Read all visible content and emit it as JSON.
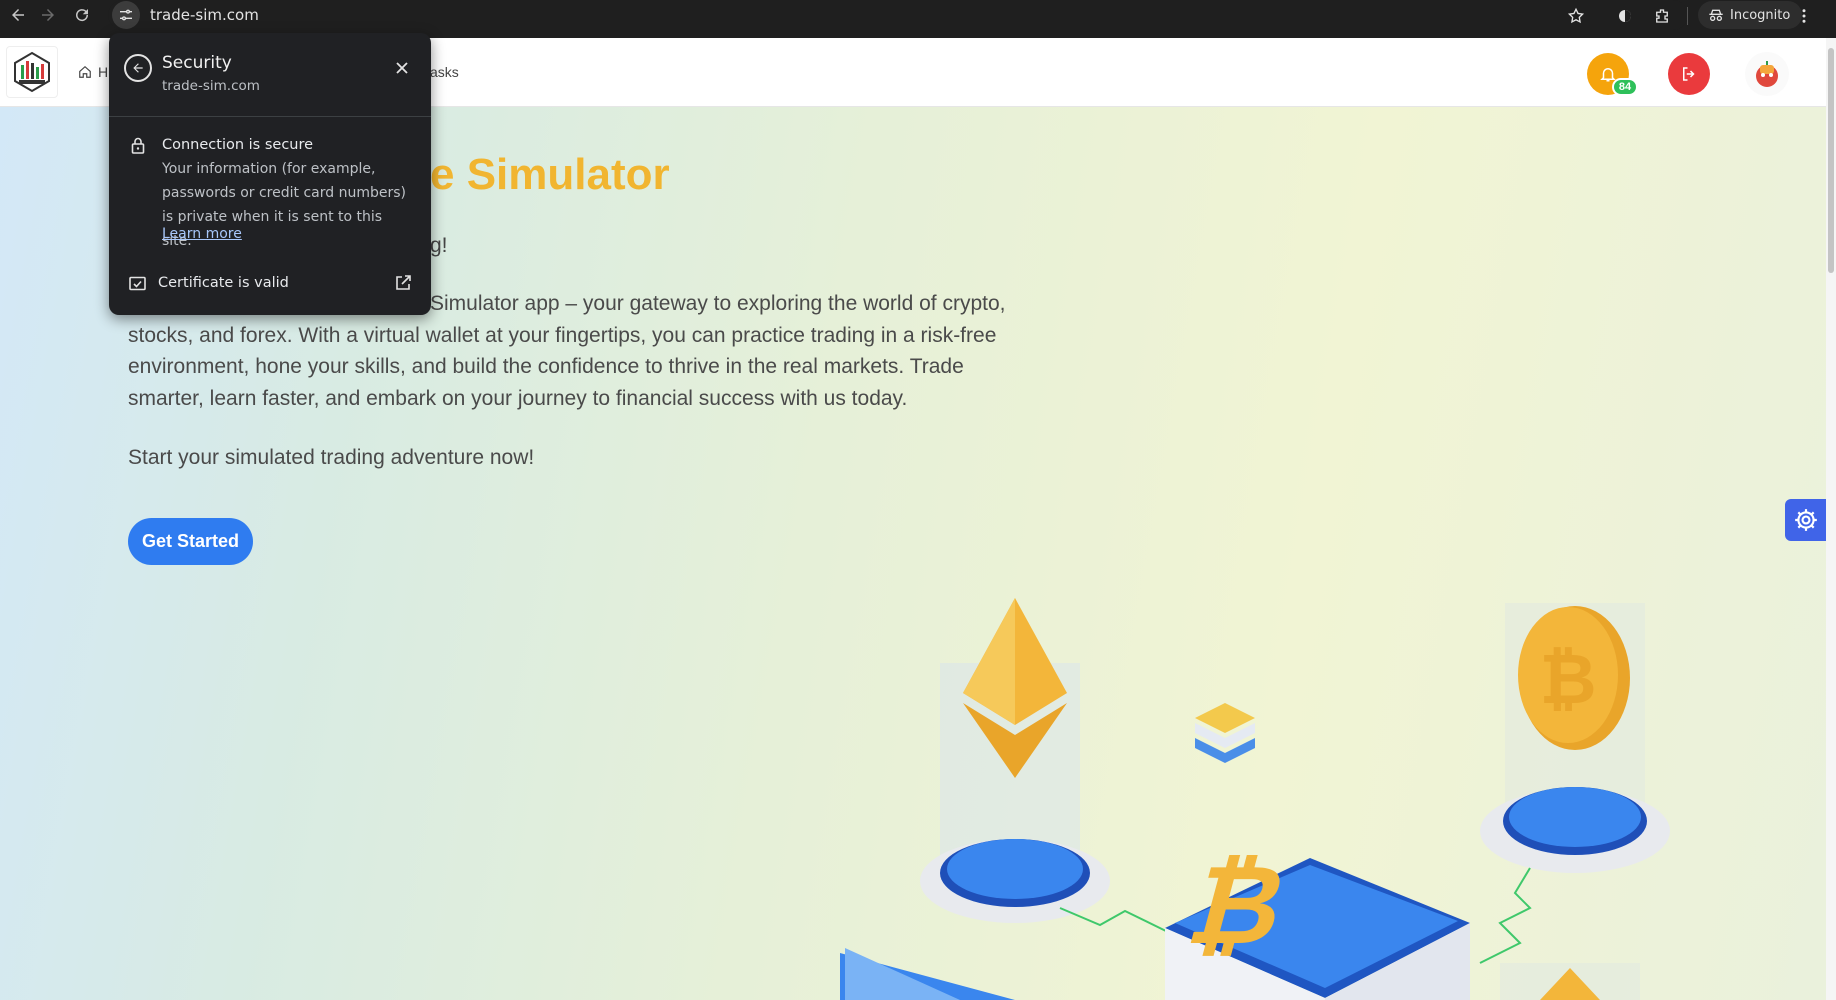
{
  "browser": {
    "url": "trade-sim.com",
    "incognito_label": "Incognito"
  },
  "topbar": {
    "nav_home_label": "H",
    "nav_tasks_label": "asks",
    "notification_count": "84"
  },
  "hero": {
    "title_visible": "e Simulator",
    "subtitle_visible": "g!",
    "paragraph_lines": [
      "Simulator app – your gateway to exploring the world of crypto,",
      "stocks, and forex. With a virtual wallet at your fingertips, you can practice trading in a risk-free",
      "environment, hone your skills, and build the confidence to thrive in the real markets. Trade",
      "smarter, learn faster, and embark on your journey to financial success with us today."
    ],
    "cta_text": "Start your simulated trading adventure now!",
    "cta_button": "Get Started"
  },
  "security_popup": {
    "title": "Security",
    "domain": "trade-sim.com",
    "connection_title": "Connection is secure",
    "connection_desc": "Your information (for example, passwords or credit card numbers) is private when it is sent to this site.",
    "learn_more": "Learn more",
    "certificate": "Certificate is valid"
  },
  "colors": {
    "title_gold": "#f1b530",
    "button_blue": "#2f7cf0",
    "notif_orange": "#f5a40c",
    "logout_red": "#ea3a3d",
    "gear_blue": "#4064e8"
  }
}
